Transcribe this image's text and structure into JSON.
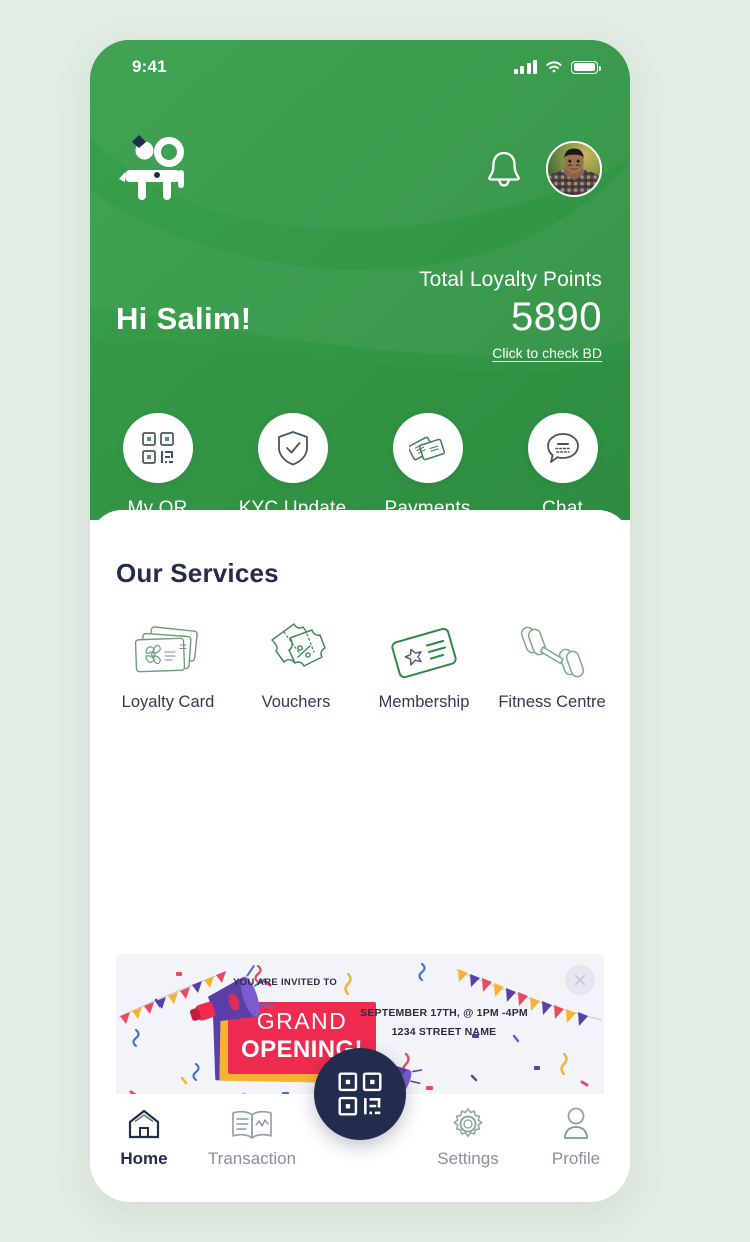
{
  "theme": {
    "page_background": "#e3ede3",
    "brand_green": "#339947",
    "dark_navy": "#232c4d",
    "sheet_white": "#ffffff",
    "muted_text": "#8a8f9e"
  },
  "status_bar": {
    "time": "9:41",
    "cellular_icon": "signal-bars-icon",
    "wifi_icon": "wifi-icon",
    "battery_icon": "battery-full-icon"
  },
  "header": {
    "logo_icon": "brand-logo-icon",
    "notification_icon": "bell-icon",
    "avatar_icon": "user-avatar",
    "greeting": "Hi Salim!",
    "points_label": "Total Loyalty Points",
    "points_value": "5890",
    "points_link": "Click to check BD"
  },
  "quick_actions": [
    {
      "label": "My QR",
      "icon": "qr-code-icon"
    },
    {
      "label": "KYC Update",
      "icon": "shield-check-icon"
    },
    {
      "label": "Payments",
      "icon": "cards-icon"
    },
    {
      "label": "Chat",
      "icon": "chat-bubble-icon"
    }
  ],
  "services_section": {
    "title": "Our Services",
    "items": [
      {
        "label": "Loyalty Card",
        "icon": "gift-cards-icon"
      },
      {
        "label": "Vouchers",
        "icon": "discount-tickets-icon"
      },
      {
        "label": "Membership",
        "icon": "membership-card-star-icon"
      },
      {
        "label": "Fitness Centre",
        "icon": "dumbbell-icon"
      }
    ]
  },
  "promo_banner": {
    "invite_text": "YOU ARE INVITED TO",
    "headline_line1": "GRAND",
    "headline_line2": "OPENING!",
    "date_text": "SEPTEMBER 17TH, @ 1PM -4PM",
    "address_text": "1234 STREET NAME",
    "close_icon": "close-icon"
  },
  "bottom_nav": {
    "items": [
      {
        "label": "Home",
        "icon": "home-icon",
        "active": true
      },
      {
        "label": "Transaction",
        "icon": "open-book-icon",
        "active": false
      },
      {
        "label": "Settings",
        "icon": "gear-icon",
        "active": false
      },
      {
        "label": "Profile",
        "icon": "person-icon",
        "active": false
      }
    ],
    "fab_icon": "qr-scan-icon"
  }
}
